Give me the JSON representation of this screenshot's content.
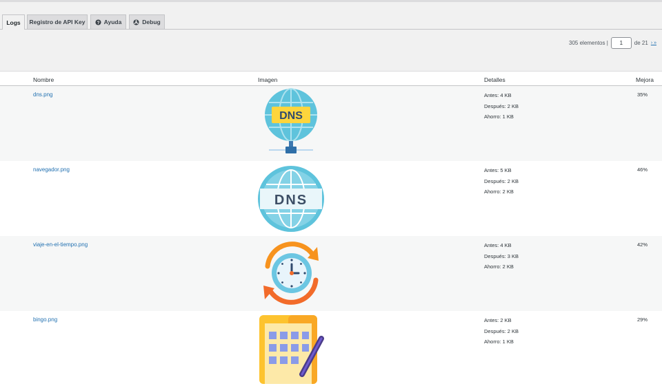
{
  "tabs": [
    {
      "label": "Logs",
      "icon": null,
      "active": true
    },
    {
      "label": "Registro de API Key",
      "icon": null,
      "active": false
    },
    {
      "label": "Ayuda",
      "icon": "help-icon",
      "active": false
    },
    {
      "label": "Debug",
      "icon": "debug-icon",
      "active": false
    }
  ],
  "pagination": {
    "items_text": "305 elementos |",
    "current_page": "1",
    "of_text": "de 21",
    "next_links": "› »"
  },
  "table": {
    "headers": {
      "name": "Nombre",
      "image": "Imagen",
      "details": "Detalles",
      "improvement": "Mejora"
    },
    "rows": [
      {
        "name": "dns.png",
        "image_icon": "dns-globe-network-icon",
        "before": "Antes: 4 KB",
        "after": "Después: 2 KB",
        "savings": "Ahorro: 1 KB",
        "improvement": "35%"
      },
      {
        "name": "navegador.png",
        "image_icon": "dns-globe-icon",
        "before": "Antes: 5 KB",
        "after": "Después: 2 KB",
        "savings": "Ahorro: 2 KB",
        "improvement": "46%"
      },
      {
        "name": "viaje-en-el-tiempo.png",
        "image_icon": "clock-cycle-icon",
        "before": "Antes: 4 KB",
        "after": "Después: 3 KB",
        "savings": "Ahorro: 2 KB",
        "improvement": "42%"
      },
      {
        "name": "bingo.png",
        "image_icon": "bingo-card-icon",
        "before": "Antes: 2 KB",
        "after": "Después: 2 KB",
        "savings": "Ahorro: 1 KB",
        "improvement": "29%"
      }
    ]
  },
  "colors": {
    "link": "#2271b1",
    "background": "#f1f1f1",
    "tab_inactive": "#dcdcde"
  }
}
